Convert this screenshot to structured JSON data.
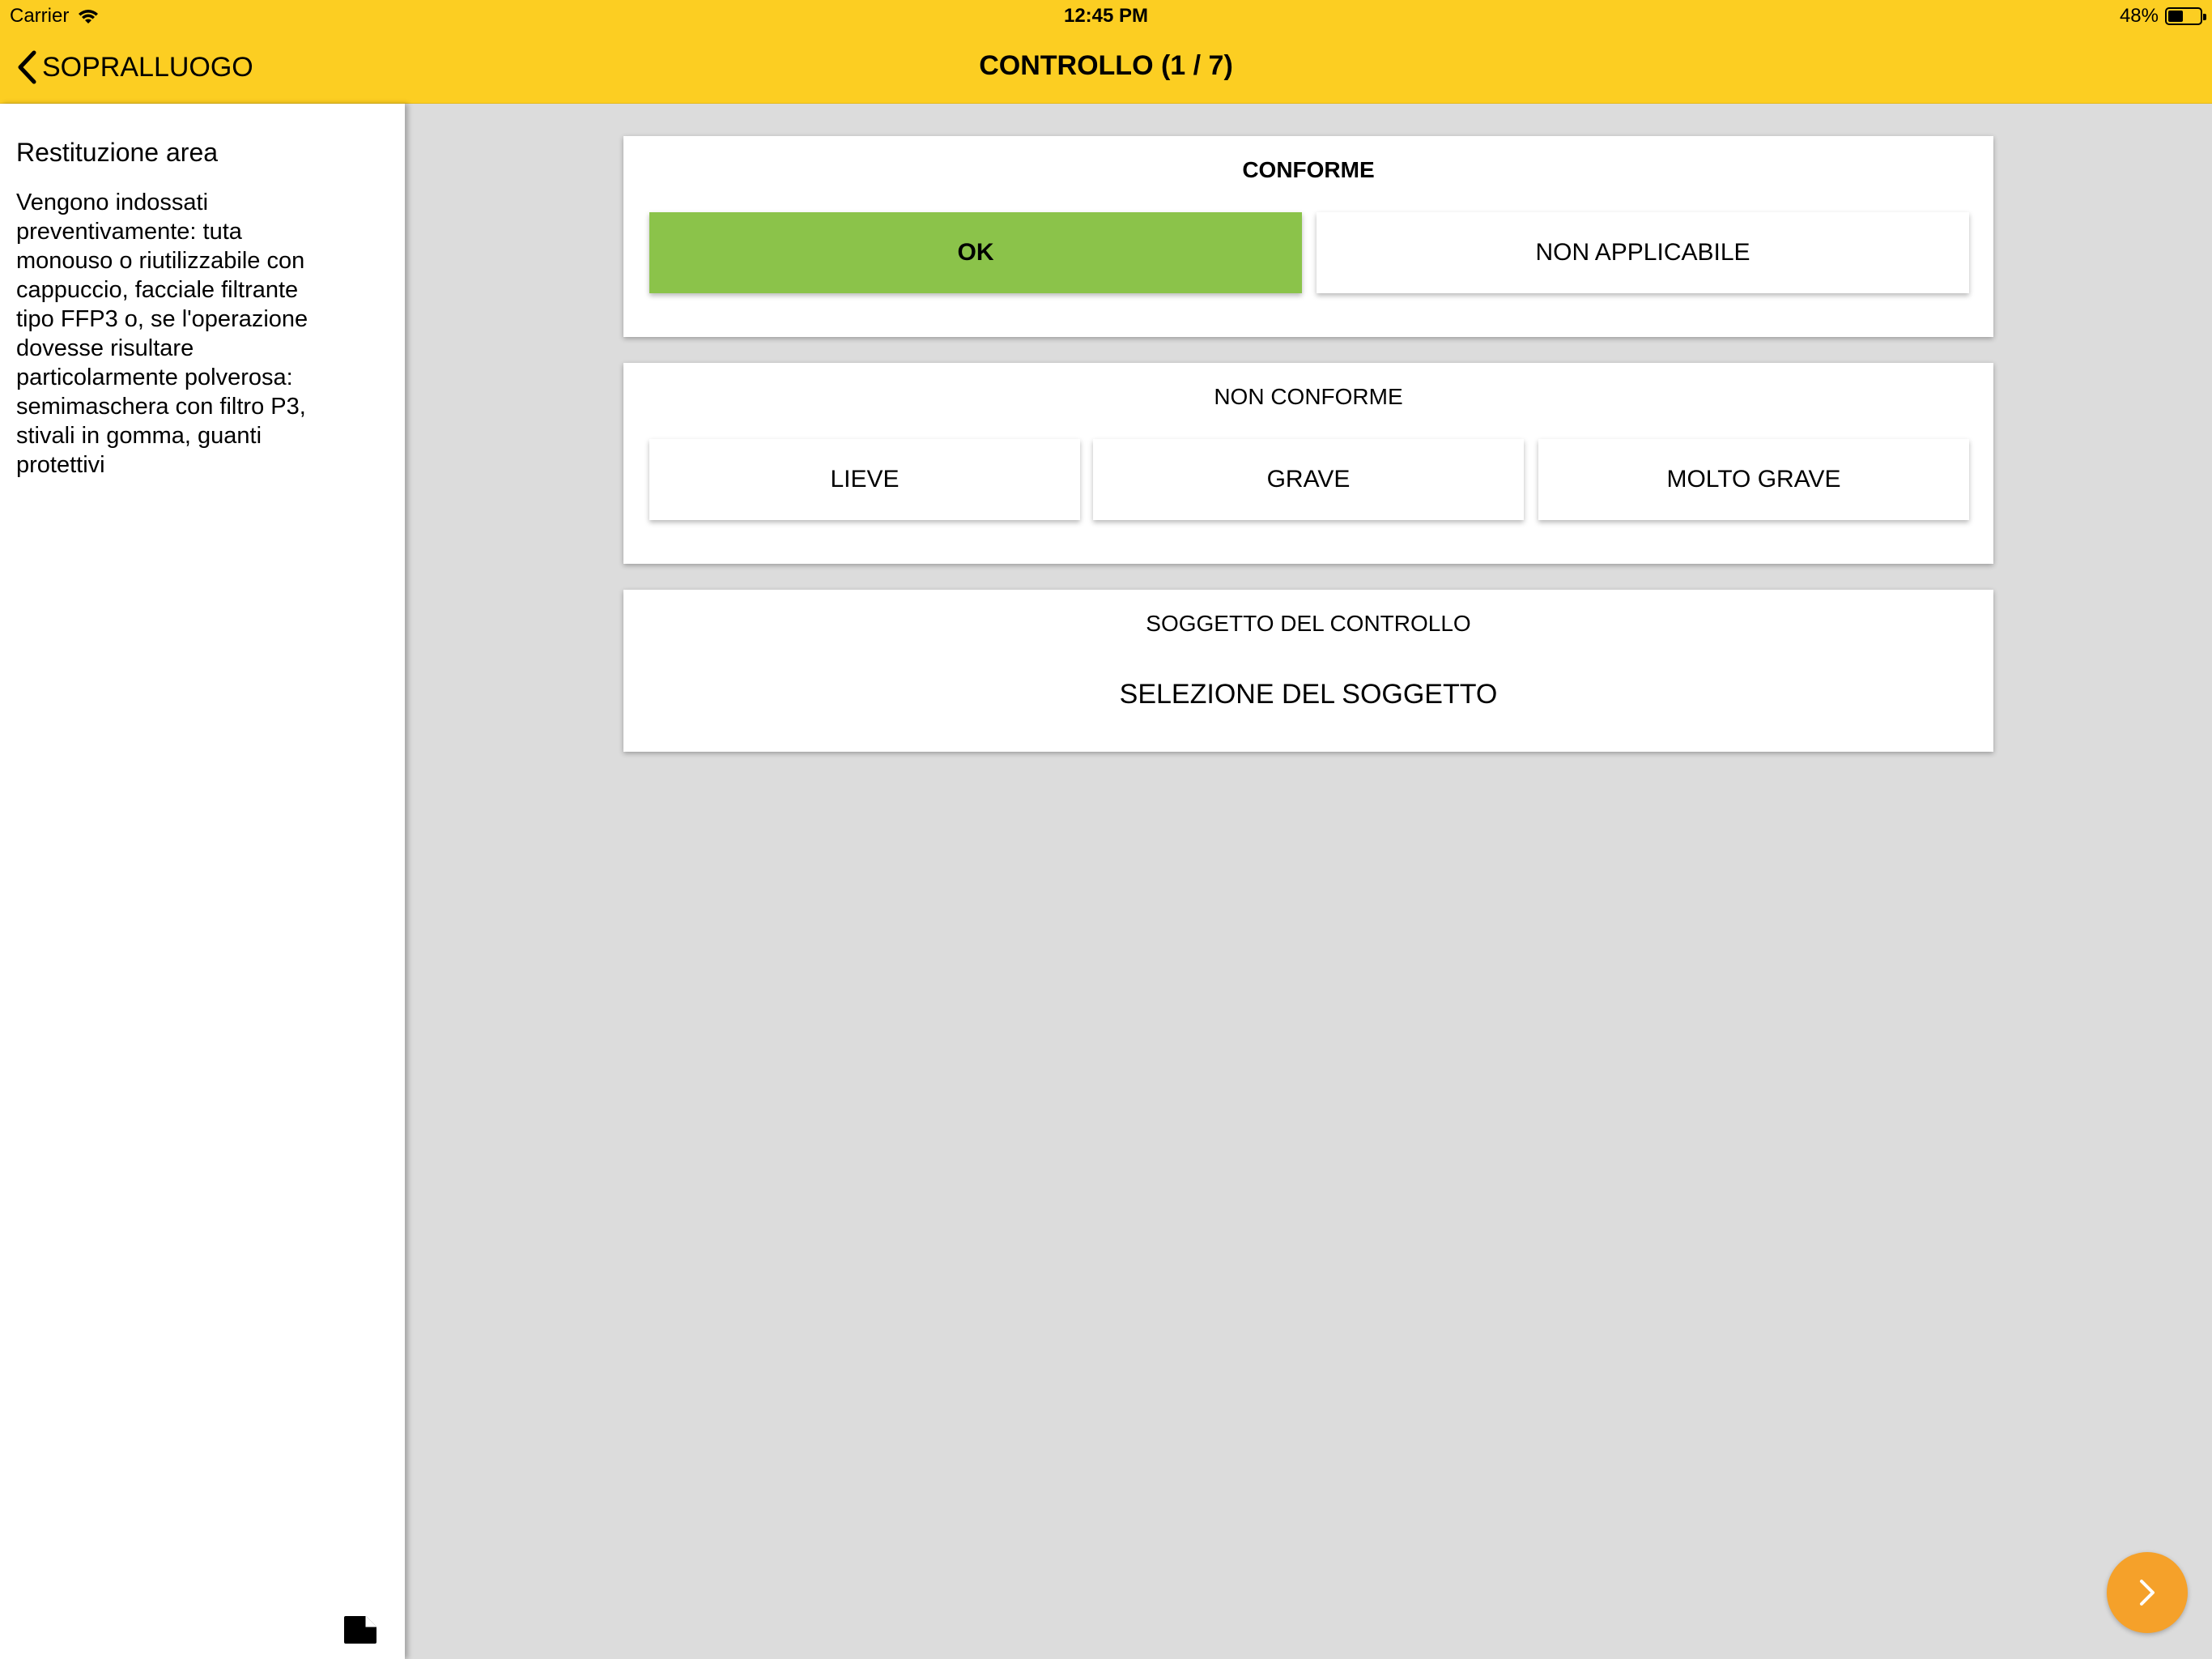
{
  "status_bar": {
    "carrier": "Carrier",
    "time": "12:45 PM",
    "battery_percent": "48%",
    "battery_level": 0.48
  },
  "nav": {
    "back_label": "SOPRALLUOGO",
    "title": "CONTROLLO (1 / 7)"
  },
  "sidebar": {
    "title": "Restituzione area",
    "description": "Vengono indossati preventivamente: tuta monouso o riutilizzabile con cappuccio, facciale filtrante tipo FFP3 o, se l'operazione dovesse risultare particolarmente polverosa: semimaschera con filtro P3, stivali in gomma, guanti protettivi"
  },
  "conforme": {
    "heading": "CONFORME",
    "options": [
      "OK",
      "NON APPLICABILE"
    ],
    "selected": "OK"
  },
  "non_conforme": {
    "heading": "NON CONFORME",
    "options": [
      "LIEVE",
      "GRAVE",
      "MOLTO GRAVE"
    ]
  },
  "soggetto": {
    "heading": "SOGGETTO DEL CONTROLLO",
    "select_label": "SELEZIONE DEL SOGGETTO"
  },
  "colors": {
    "nav_background": "#fcce22",
    "selected_option": "#8bc34a",
    "fab": "#f5a12a",
    "content_background": "#dcdcdc"
  },
  "icons": {
    "wifi": "wifi-icon",
    "battery": "battery-icon",
    "back": "chevron-left-icon",
    "note": "note-icon",
    "next": "chevron-right-icon"
  }
}
